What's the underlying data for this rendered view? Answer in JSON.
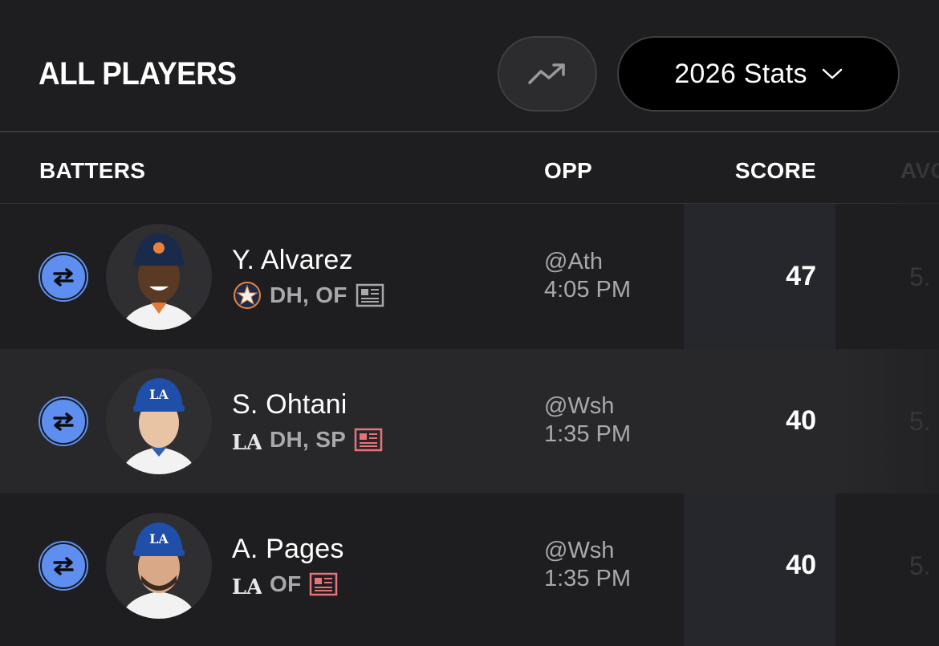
{
  "header": {
    "title": "ALL PLAYERS",
    "trend_icon": "trending-up-icon",
    "stats_select": "2026 Stats"
  },
  "columns": {
    "batters": "BATTERS",
    "opp": "OPP",
    "score": "SCORE",
    "avg": "AVG"
  },
  "players": [
    {
      "name": "Y. Alvarez",
      "team": "Astros",
      "positions": "DH, OF",
      "opp": "@Ath",
      "time": "4:05 PM",
      "score": "47",
      "avg": "5.",
      "news_highlight": false
    },
    {
      "name": "S. Ohtani",
      "team": "Dodgers",
      "positions": "DH, SP",
      "opp": "@Wsh",
      "time": "1:35 PM",
      "score": "40",
      "avg": "5.",
      "news_highlight": true
    },
    {
      "name": "A. Pages",
      "team": "Dodgers",
      "positions": "OF",
      "opp": "@Wsh",
      "time": "1:35 PM",
      "score": "40",
      "avg": "5.",
      "news_highlight": true
    }
  ],
  "colors": {
    "background": "#1e1e20",
    "swap_button": "#5e8ff0",
    "score_column": "#25272c",
    "news_highlight": "#e8737a",
    "news_default": "#a9a9ad"
  }
}
